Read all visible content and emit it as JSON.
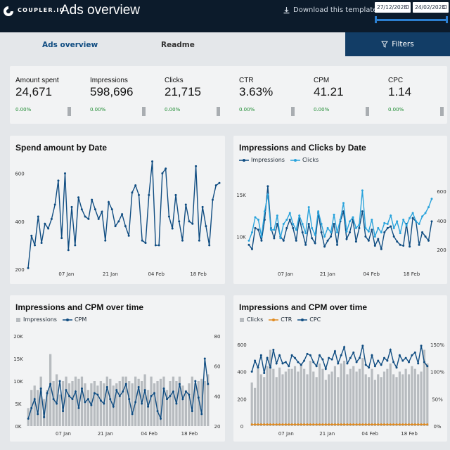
{
  "header": {
    "brand": "COUPLER.IO",
    "title": "Ads overview",
    "download_label": "Download this template",
    "date_start": "27/12/2023",
    "date_end": "24/02/2024"
  },
  "tabs": [
    {
      "label": "Ads overview"
    },
    {
      "label": "Readme"
    }
  ],
  "filters_label": "Filters",
  "kpis": [
    {
      "label": "Amount spent",
      "value": "24,671",
      "delta": "0.00%"
    },
    {
      "label": "Impressions",
      "value": "598,696",
      "delta": "0.00%"
    },
    {
      "label": "Clicks",
      "value": "21,715",
      "delta": "0.00%"
    },
    {
      "label": "CTR",
      "value": "3.63%",
      "delta": "0.00%"
    },
    {
      "label": "CPM",
      "value": "41.21",
      "delta": "0.00%"
    },
    {
      "label": "CPC",
      "value": "1.14",
      "delta": "0.00%"
    }
  ],
  "colors": {
    "accent": "#0f4c81",
    "light_blue": "#29a3dc",
    "grey_bar": "#b7bbbf",
    "ctr_orange": "#e08a1e",
    "topbar": "#0c1b2b",
    "filters_bg": "#123d66",
    "positive": "#1b8a2f"
  },
  "icons": [
    "coupler-logo-icon",
    "download-icon",
    "calendar-icon",
    "filter-icon"
  ],
  "chart_data": [
    {
      "type": "line",
      "title": "Spend amount by Date",
      "x_ticks": [
        "07 Jan",
        "21 Jan",
        "04 Feb",
        "18 Feb"
      ],
      "y_ticks": [
        "200",
        "400",
        "600"
      ],
      "ylim": [
        200,
        640
      ],
      "series": [
        {
          "values": [
            205,
            340,
            300,
            420,
            310,
            390,
            370,
            410,
            470,
            570,
            330,
            600,
            280,
            460,
            300,
            500,
            450,
            420,
            410,
            490,
            450,
            410,
            440,
            320,
            480,
            450,
            380,
            400,
            430,
            380,
            340,
            520,
            550,
            510,
            320,
            310,
            510,
            650,
            300,
            300,
            600,
            620,
            420,
            370,
            510,
            400,
            320,
            470,
            400,
            390,
            630,
            320,
            460,
            380,
            300,
            490,
            550,
            560
          ]
        }
      ]
    },
    {
      "type": "line",
      "title": "Impressions and Clicks by Date",
      "x_ticks": [
        "07 Jan",
        "21 Jan",
        "04 Feb",
        "18 Feb"
      ],
      "y_ticks_left": [
        "10K",
        "15K"
      ],
      "y_ticks_right": [
        "200",
        "400",
        "600"
      ],
      "series": [
        {
          "name": "Impressions",
          "values": [
            9000,
            8500,
            11000,
            10800,
            9500,
            12000,
            16000,
            11000,
            9800,
            11500,
            10000,
            9500,
            11000,
            12000,
            11000,
            9500,
            12200,
            10500,
            9000,
            11500,
            9800,
            9200,
            12800,
            10500,
            8800,
            9500,
            10000,
            11500,
            9000,
            11800,
            13000,
            9700,
            10500,
            12000,
            9400,
            11000,
            13000,
            10000,
            9500,
            10800,
            8900,
            9700,
            8500,
            10500,
            11000,
            11200,
            10000,
            9400,
            9000,
            8900,
            11500,
            8800,
            12200,
            11800,
            9000,
            10500,
            10000,
            9500,
            11800
          ]
        },
        {
          "name": "Clicks",
          "values": [
            9500,
            10500,
            12300,
            12000,
            10000,
            13000,
            15000,
            10800,
            10800,
            12500,
            9800,
            11500,
            12000,
            12800,
            11500,
            10800,
            12500,
            11500,
            10400,
            13500,
            11000,
            10200,
            13000,
            11500,
            10000,
            11000,
            10500,
            12600,
            10500,
            12000,
            14000,
            10600,
            11800,
            12300,
            11000,
            11400,
            15500,
            11000,
            10600,
            12000,
            10000,
            11000,
            10500,
            11600,
            11500,
            12500,
            11000,
            11800,
            10400,
            12000,
            11300,
            12200,
            12800,
            11800,
            11500,
            12400,
            12800,
            13500,
            14500
          ]
        }
      ]
    },
    {
      "type": "bar",
      "title": "Impressions and CPM over time",
      "x_ticks": [
        "07 Jan",
        "21 Jan",
        "04 Feb",
        "18 Feb"
      ],
      "y_ticks_left": [
        "0K",
        "5K",
        "10K",
        "15K",
        "20K"
      ],
      "y_ticks_right": [
        "20",
        "40",
        "60",
        "80"
      ],
      "series": [
        {
          "name": "Impressions",
          "values": [
            4000,
            8000,
            9000,
            8000,
            11000,
            6000,
            8000,
            16000,
            10000,
            11500,
            7000,
            10000,
            11000,
            9500,
            10000,
            11000,
            10500,
            11000,
            9500,
            8000,
            9500,
            10000,
            9000,
            10000,
            9500,
            11000,
            10500,
            9000,
            9500,
            10000,
            11000,
            11000,
            10000,
            9500,
            11000,
            10500,
            10000,
            11500,
            8000,
            11000,
            9500,
            10000,
            10500,
            11000,
            8000,
            10000,
            11000,
            10000,
            11000,
            9000,
            8000,
            9500,
            11000,
            9500,
            10000,
            10500,
            10000,
            11500
          ]
        },
        {
          "name": "CPM",
          "values": [
            25,
            32,
            38,
            28,
            45,
            26,
            42,
            48,
            38,
            35,
            50,
            30,
            44,
            40,
            38,
            43,
            32,
            45,
            36,
            38,
            34,
            42,
            41,
            37,
            35,
            46,
            38,
            33,
            44,
            40,
            43,
            48,
            38,
            28,
            36,
            46,
            35,
            44,
            33,
            40,
            42,
            30,
            25,
            45,
            38,
            40,
            43,
            35,
            48,
            38,
            43,
            41,
            30,
            50,
            39,
            28,
            65,
            48
          ]
        }
      ]
    },
    {
      "type": "bar",
      "title": "Impressions and CPM over time",
      "x_ticks": [
        "07 Jan",
        "21 Jan",
        "04 Feb",
        "18 Feb"
      ],
      "y_ticks_left": [
        "0",
        "200",
        "400",
        "600"
      ],
      "y_ticks_right": [
        "0%",
        "50%",
        "100%",
        "150%"
      ],
      "series": [
        {
          "name": "Clicks",
          "values": [
            320,
            280,
            420,
            380,
            360,
            440,
            560,
            420,
            360,
            430,
            380,
            400,
            420,
            420,
            440,
            400,
            460,
            420,
            380,
            480,
            400,
            360,
            460,
            420,
            340,
            380,
            400,
            440,
            360,
            460,
            480,
            380,
            420,
            440,
            400,
            420,
            500,
            380,
            360,
            420,
            340,
            380,
            360,
            400,
            420,
            460,
            380,
            360,
            400,
            380,
            420,
            380,
            440,
            420,
            380,
            400,
            560,
            460
          ]
        },
        {
          "name": "CTR",
          "values": [
            3,
            3,
            3,
            3,
            3,
            3,
            3,
            3,
            3,
            3,
            3,
            3,
            3,
            3,
            3,
            3,
            3,
            3,
            3,
            3,
            3,
            3,
            3,
            3,
            3,
            3,
            3,
            3,
            3,
            3,
            3,
            3,
            3,
            3,
            3,
            3,
            3,
            3,
            3,
            3,
            3,
            3,
            3,
            3,
            3,
            3,
            3,
            3,
            3,
            3,
            3,
            3,
            3,
            3,
            3,
            3,
            3,
            3
          ]
        },
        {
          "name": "CPC",
          "values": [
            400,
            480,
            430,
            520,
            390,
            500,
            430,
            560,
            460,
            520,
            460,
            470,
            440,
            520,
            500,
            470,
            450,
            480,
            530,
            520,
            470,
            440,
            520,
            490,
            420,
            500,
            490,
            550,
            460,
            520,
            580,
            460,
            500,
            540,
            470,
            500,
            590,
            450,
            430,
            520,
            440,
            480,
            450,
            500,
            480,
            560,
            470,
            430,
            520,
            480,
            500,
            470,
            520,
            540,
            460,
            590,
            470,
            440
          ]
        }
      ]
    }
  ]
}
